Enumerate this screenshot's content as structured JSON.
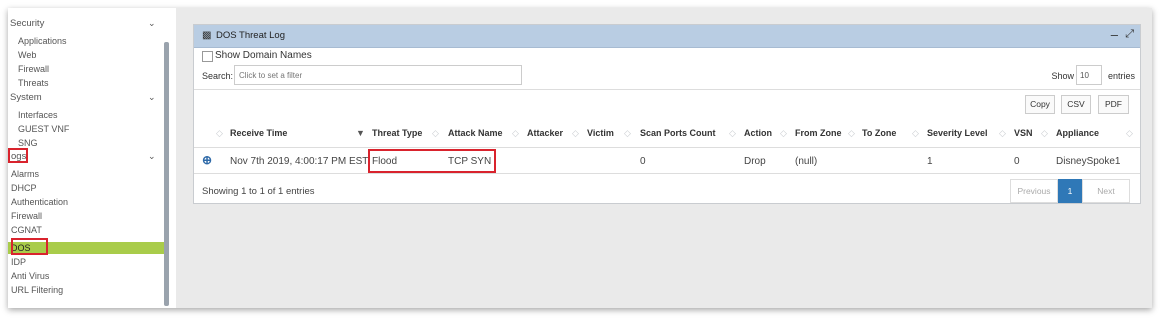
{
  "sidebar": {
    "security": "Security",
    "security_items": [
      "Applications",
      "Web",
      "Firewall",
      "Threats"
    ],
    "system": "System",
    "system_items": [
      "Interfaces",
      "GUEST VNF",
      "SNG"
    ],
    "logs": "Logs",
    "logs_visible": "ogs",
    "logs_items": [
      "Alarms",
      "DHCP",
      "Authentication",
      "Firewall",
      "CGNAT",
      "DOS",
      "IDP",
      "Anti Virus",
      "URL Filtering"
    ],
    "active_item": "DOS"
  },
  "panel": {
    "title": "DOS Threat Log",
    "title_icon": "bar-chart-icon",
    "show_domain_names": "Show Domain Names",
    "search_label": "Search:",
    "search_placeholder": "Click to set a filter",
    "show_label": "Show",
    "show_value": "10",
    "entries_label": "entries",
    "buttons": {
      "copy": "Copy",
      "csv": "CSV",
      "pdf": "PDF"
    }
  },
  "table": {
    "columns": [
      "Receive Time",
      "Threat Type",
      "Attack Name",
      "Attacker",
      "Victim",
      "Scan Ports Count",
      "Action",
      "From Zone",
      "To Zone",
      "Severity Level",
      "VSN",
      "Appliance"
    ],
    "rows": [
      {
        "receive_time": "Nov 7th 2019, 4:00:17 PM EST",
        "threat_type": "Flood",
        "attack_name": "TCP SYN",
        "attacker": "",
        "victim": "",
        "scan_ports_count": "0",
        "action": "Drop",
        "from_zone": "(null)",
        "to_zone": "",
        "severity_level": "1",
        "vsn": "0",
        "appliance": "DisneySpoke1"
      }
    ]
  },
  "footer": {
    "info": "Showing 1 to 1 of 1 entries",
    "previous": "Previous",
    "page": "1",
    "next": "Next"
  },
  "colors": {
    "panel_header": "#b9cde3",
    "active_sidebar": "#a9cc4a",
    "highlight_box": "#d9232d",
    "page_active": "#2f78b7"
  }
}
